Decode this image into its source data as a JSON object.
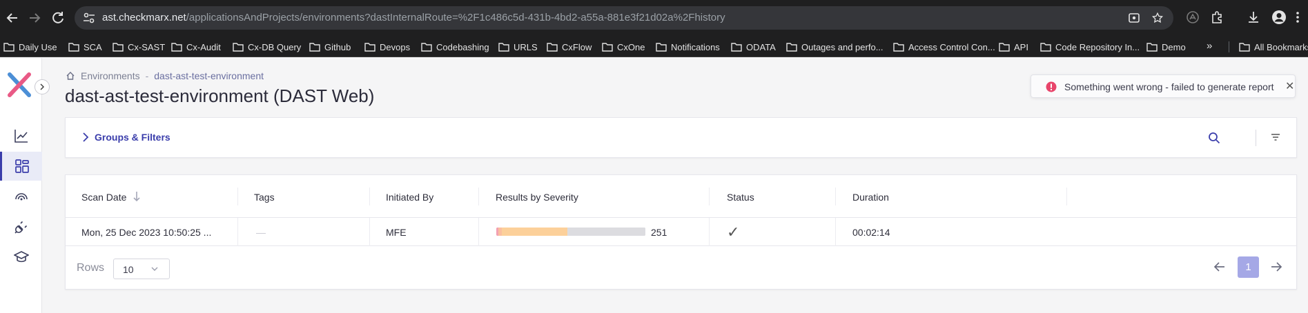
{
  "browser": {
    "url_host": "ast.checkmarx.net",
    "url_path": "/applicationsAndProjects/environments?dastInternalRoute=%2F1c486c5d-431b-4bd2-a55a-881e3f21d02a%2Fhistory",
    "bookmarks": [
      "Daily Use",
      "SCA",
      "Cx-SAST",
      "Cx-Audit",
      "Cx-DB Query",
      "Github",
      "Devops",
      "Codebashing",
      "URLS",
      "CxFlow",
      "CxOne",
      "Notifications",
      "ODATA",
      "Outages and perfo...",
      "Access Control Con...",
      "API",
      "Code Repository In...",
      "Demo"
    ],
    "more_label": "»",
    "all_bookmarks": "All Bookmarks"
  },
  "breadcrumb": {
    "parent": "Environments",
    "separator": "-",
    "current": "dast-ast-test-environment"
  },
  "page_title": "dast-ast-test-environment (DAST Web)",
  "toast": {
    "message": "Something went wrong - failed to generate report",
    "close": "✕"
  },
  "filters": {
    "label": "Groups & Filters"
  },
  "table": {
    "columns": [
      "Scan Date",
      "Tags",
      "Initiated By",
      "Results by Severity",
      "Status",
      "Duration"
    ],
    "rows": [
      {
        "scan_date": "Mon, 25 Dec 2023 10:50:25 ...",
        "tags": "—",
        "initiated_by": "MFE",
        "severity_total": "251",
        "status": "✓",
        "duration": "00:02:14"
      }
    ]
  },
  "severity_breakdown": [
    {
      "level": "high",
      "share": 0.015,
      "color": "#f3a1b2"
    },
    {
      "level": "medium",
      "share": 0.024,
      "color": "#fbbfa0"
    },
    {
      "level": "low",
      "share": 0.44,
      "color": "#fcd09a"
    },
    {
      "level": "info",
      "share": 0.521,
      "color": "#dcdce0"
    }
  ],
  "pagination": {
    "rows_label": "Rows",
    "rows_value": "10",
    "current_page": "1"
  },
  "colors": {
    "accent": "#3a3dab",
    "toast_error": "#e8456b",
    "page_active": "#a5a8e6"
  }
}
